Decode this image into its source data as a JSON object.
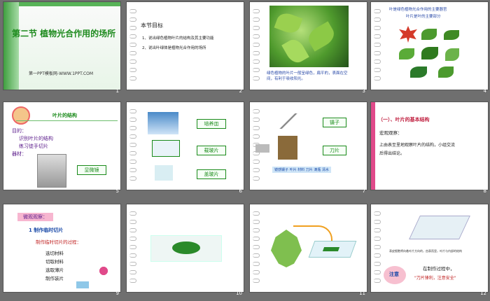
{
  "slides": [
    {
      "num": "1",
      "title": "第二节 植物光合作用的场所",
      "footer": "第一PPT模板网-WWW.1PPT.COM"
    },
    {
      "num": "2",
      "heading": "本节目标",
      "items": [
        "1、说出绿色植物叶片的结构及其主要功能",
        "2、说出叶绿体是植物光合作用的场所"
      ]
    },
    {
      "num": "3",
      "caption_lines": [
        "绿色植物的叶片一般呈绿色，扁平的，表面在空间，有利于吸收阳光。"
      ]
    },
    {
      "num": "4",
      "header_lines": [
        "叶是绿色植物光合作用的主要器官",
        "叶片是叶的主要部分"
      ]
    },
    {
      "num": "5",
      "title": "叶片的结构",
      "lines": [
        "目的：",
        "识别叶片的结构",
        "练习徒手切片",
        "器材："
      ],
      "box": "显微镜"
    },
    {
      "num": "6",
      "labels": [
        "培养皿",
        "载玻片",
        "盖玻片"
      ]
    },
    {
      "num": "7",
      "labels": [
        "镊子",
        "刀片"
      ],
      "note": "镜感镊子 叶片 材料 刀片 滴瓶 清水"
    },
    {
      "num": "8",
      "heading": "（一）、叶片的基本结构",
      "sub": "宏观观察：",
      "body": [
        "上由表至里地观察叶片的结构，小组交流",
        "后得出结论。"
      ]
    },
    {
      "num": "9",
      "heading": "微观观察：",
      "step": "1  制作临时切片",
      "sub": "制作临时切片的过程：",
      "items": [
        "选切材料",
        "切取材料",
        "选取薄片",
        "制作装片"
      ]
    },
    {
      "num": "10"
    },
    {
      "num": "11"
    },
    {
      "num": "12",
      "caption": "表皮细胞将向着叶片方向的，由表而里，叶片与内部的结构",
      "badge": "注意",
      "text1": "在制作过程中，",
      "text2": "\"刀片锋利，注意安全\""
    }
  ]
}
